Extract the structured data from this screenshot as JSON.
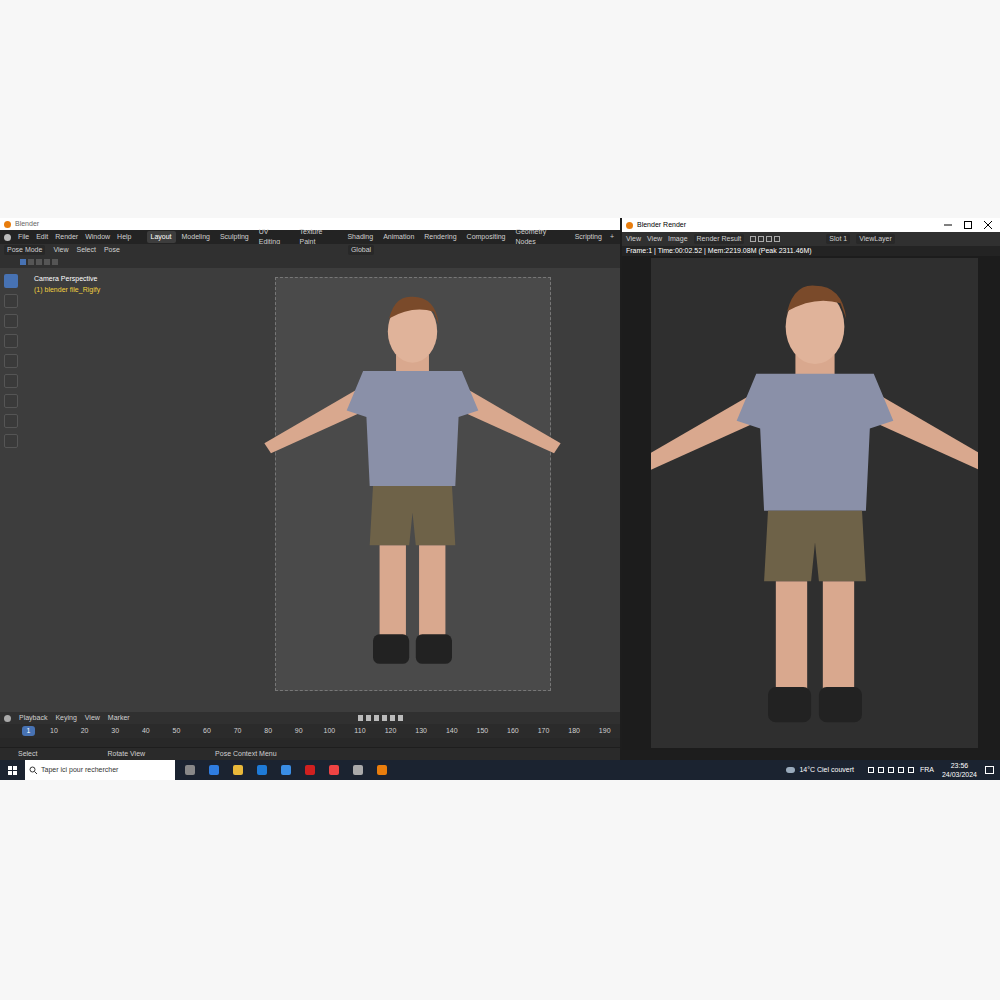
{
  "blender": {
    "title": "Blender",
    "menu": [
      "File",
      "Edit",
      "Render",
      "Window",
      "Help"
    ],
    "workspaces": [
      {
        "label": "Layout",
        "selected": true
      },
      {
        "label": "Modeling",
        "selected": false
      },
      {
        "label": "Sculpting",
        "selected": false
      },
      {
        "label": "UV Editing",
        "selected": false
      },
      {
        "label": "Texture Paint",
        "selected": false
      },
      {
        "label": "Shading",
        "selected": false
      },
      {
        "label": "Animation",
        "selected": false
      },
      {
        "label": "Rendering",
        "selected": false
      },
      {
        "label": "Compositing",
        "selected": false
      },
      {
        "label": "Geometry Nodes",
        "selected": false
      },
      {
        "label": "Scripting",
        "selected": false
      }
    ],
    "add_workspace": "+",
    "header": {
      "mode": "Pose Mode",
      "menus": [
        "View",
        "Select",
        "Pose"
      ],
      "orientation": "Global"
    },
    "viewport": {
      "camera": "Camera Perspective",
      "object": "(1) blender file_Rigify"
    },
    "timeline": {
      "menus": [
        "Playback",
        "Keying",
        "View",
        "Marker"
      ],
      "current_frame": "1",
      "ticks": [
        "10",
        "20",
        "30",
        "40",
        "50",
        "60",
        "70",
        "80",
        "90",
        "100",
        "110",
        "120",
        "130",
        "140",
        "150",
        "160",
        "170",
        "180",
        "190"
      ]
    },
    "status_bar": [
      "Select",
      "Rotate View",
      "Pose Context Menu"
    ]
  },
  "render_window": {
    "title": "Blender Render",
    "menus": [
      "View",
      "View",
      "Image"
    ],
    "image": "Render Result",
    "slot": "Slot 1",
    "view_layer": "ViewLayer",
    "info": "Frame:1 | Time:00:02.52 | Mem:2219.08M (Peak 2311.46M)"
  },
  "taskbar": {
    "search_placeholder": "Taper ici pour rechercher",
    "weather": "14°C Ciel couvert",
    "language": "FRA",
    "time": "23:56",
    "date": "24/03/2024"
  }
}
